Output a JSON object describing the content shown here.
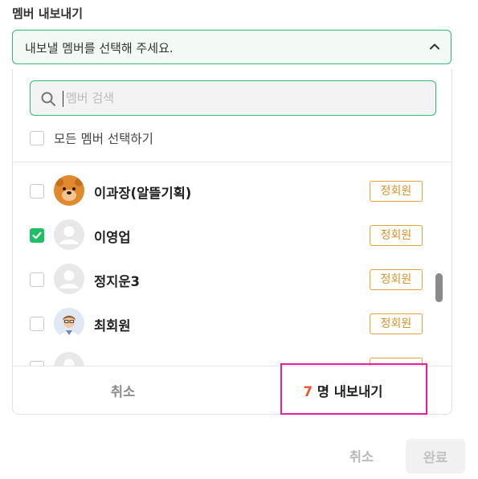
{
  "section_title": "멤버 내보내기",
  "member_select": {
    "placeholder_text": "내보낼 멤버를 선택해 주세요.",
    "expanded": true,
    "icon": "chevron-up-icon"
  },
  "search": {
    "placeholder": "멤버 검색",
    "value": "",
    "icon": "search-icon"
  },
  "select_all": {
    "label": "모든 멤버 선택하기",
    "checked": false
  },
  "members": [
    {
      "name": "이과장(알뜰기획)",
      "badge": "정회원",
      "checked": false,
      "avatar": "bear-avatar"
    },
    {
      "name": "이영업",
      "badge": "정회원",
      "checked": true,
      "avatar": "default-avatar"
    },
    {
      "name": "정지운3",
      "badge": "정회원",
      "checked": false,
      "avatar": "default-avatar"
    },
    {
      "name": "최회원",
      "badge": "정회원",
      "checked": false,
      "avatar": "person-avatar"
    },
    {
      "name": "",
      "badge": "",
      "checked": false,
      "avatar": "default-avatar"
    }
  ],
  "panel_footer": {
    "cancel_label": "취소",
    "export_count": "7",
    "export_label": "명 내보내기"
  },
  "page_footer": {
    "cancel_label": "취소",
    "done_label": "완료"
  },
  "colors": {
    "accent_green": "#2fbf71",
    "checkbox_green": "#1fbf66",
    "badge_orange": "#d7922a",
    "count_red": "#e8552a",
    "highlight_magenta": "#e91e9c"
  }
}
